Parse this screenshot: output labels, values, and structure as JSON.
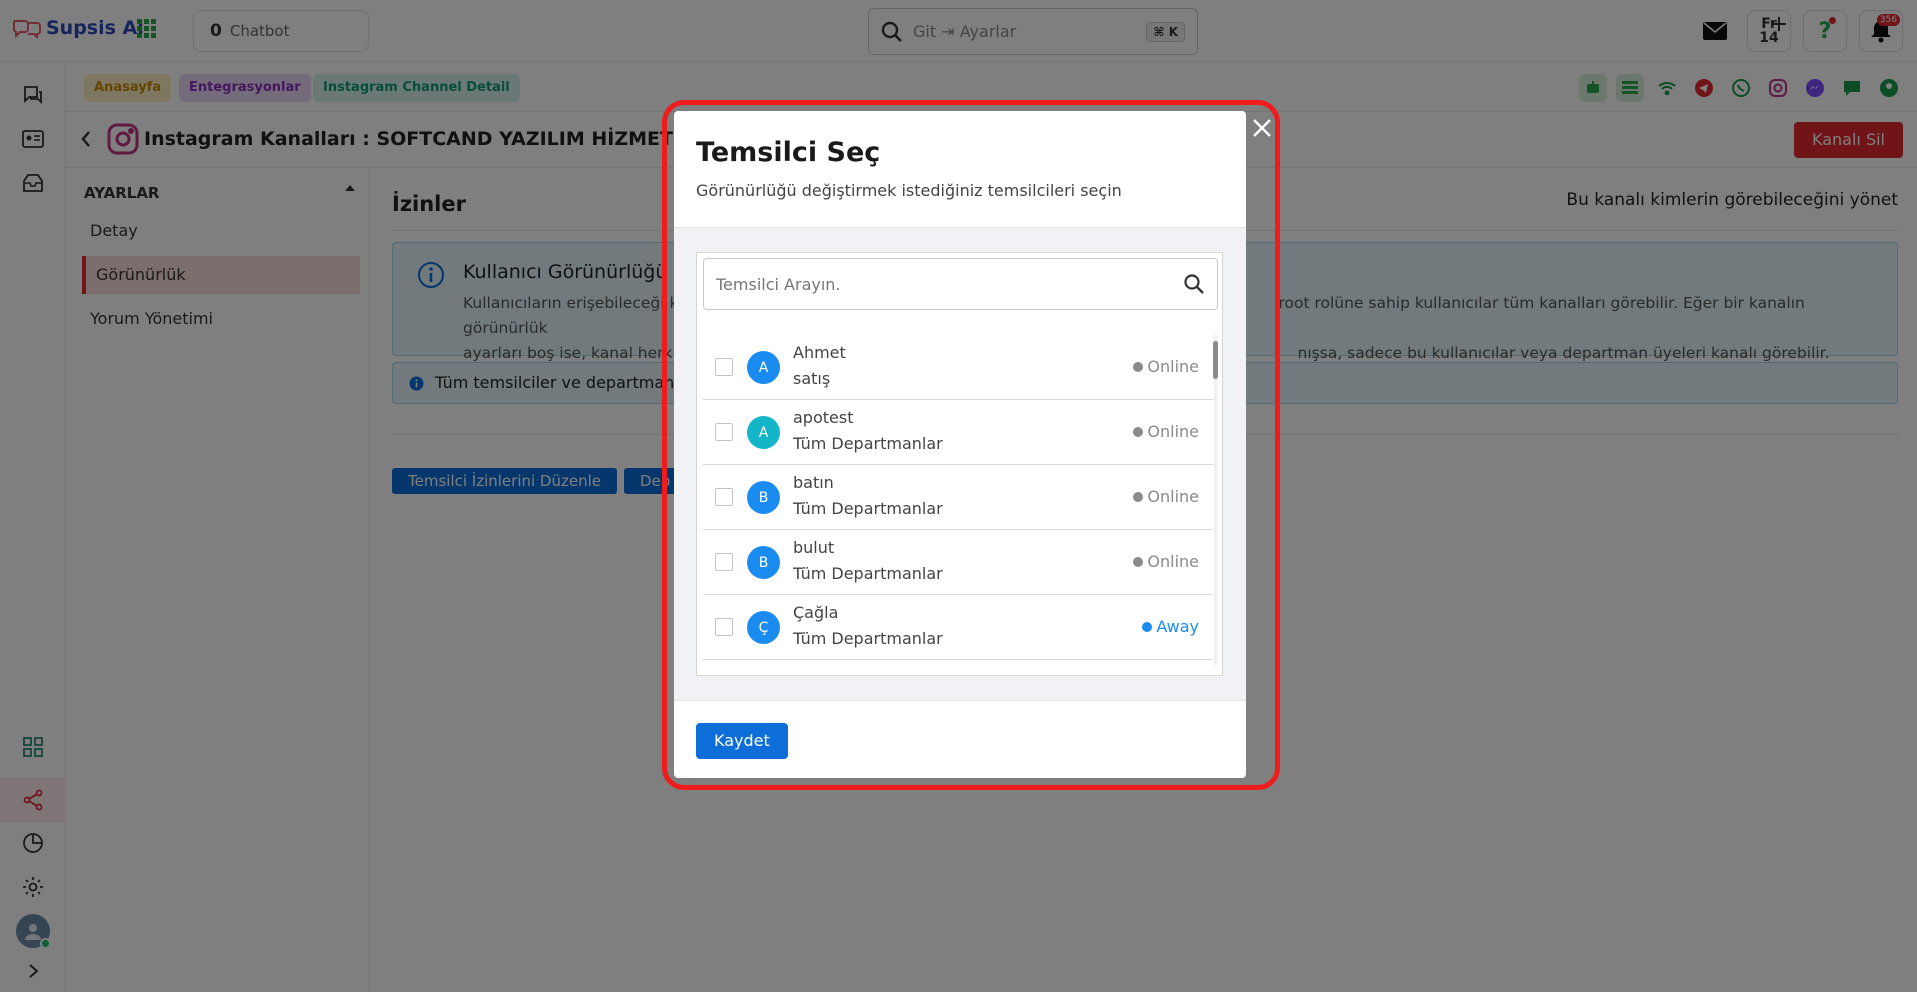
{
  "app": {
    "brand": "Supsis Ai"
  },
  "topbar": {
    "chatbot_count": "0",
    "chatbot_label": "Chatbot",
    "search_placeholder": "Git ⇥ Ayarlar",
    "search_shortcut": "⌘ K",
    "date_day": "Fr",
    "date_num": "14",
    "notification_count": "356"
  },
  "breadcrumb": [
    "Anasayfa",
    "Entegrasyonlar",
    "Instagram Channel Detail"
  ],
  "page": {
    "title": "Instagram Kanalları : SOFTCAND YAZILIM HİZMETLERİ",
    "delete_label": "Kanalı Sil"
  },
  "settings_sidebar": {
    "header": "AYARLAR",
    "items": [
      {
        "label": "Detay",
        "active": false
      },
      {
        "label": "Görünürlük",
        "active": true
      },
      {
        "label": "Yorum Yönetimi",
        "active": false
      }
    ]
  },
  "main": {
    "title": "İzinler",
    "right_text": "Bu kanalı kimlerin görebileceğini yönet",
    "info_title": "Kullanıcı Görünürlüğü",
    "info_text_left_1": "Kullanıcıların erişebileceği k",
    "info_text_right_1": "root rolüne sahip kullanıcılar tüm kanalları görebilir. Eğer bir kanalın görünürlük",
    "info_text_left_2": "ayarları boş ise, kanal herk",
    "info_text_right_2": "nışsa, sadece bu kullanıcılar veya departman üyeleri kanalı görebilir.",
    "info_bar_text": "Tüm temsilciler ve departmanla",
    "edit_agent_perms": "Temsilci İzinlerini Düzenle",
    "dept_button_partial": "Dep"
  },
  "modal": {
    "title": "Temsilci Seç",
    "subtitle": "Görünürlüğü değiştirmek istediğiniz temsilcileri seçin",
    "search_placeholder": "Temsilci Arayın.",
    "save_label": "Kaydet",
    "agents": [
      {
        "initial": "A",
        "name": "Ahmet",
        "department": "satış",
        "status": "Online",
        "avatar_color": "#1a8cf0",
        "status_color": "#8a8a8a"
      },
      {
        "initial": "A",
        "name": "apotest",
        "department": "Tüm Departmanlar",
        "status": "Online",
        "avatar_color": "#13b5c8",
        "status_color": "#8a8a8a"
      },
      {
        "initial": "B",
        "name": "batın",
        "department": "Tüm Departmanlar",
        "status": "Online",
        "avatar_color": "#1a8cf0",
        "status_color": "#8a8a8a"
      },
      {
        "initial": "B",
        "name": "bulut",
        "department": "Tüm Departmanlar",
        "status": "Online",
        "avatar_color": "#1a8cf0",
        "status_color": "#8a8a8a"
      },
      {
        "initial": "Ç",
        "name": "Çağla",
        "department": "Tüm Departmanlar",
        "status": "Away",
        "avatar_color": "#1a8cf0",
        "status_color": "#1a8cf0"
      }
    ]
  },
  "colors": {
    "accent": "#0d6ed9",
    "danger": "#e0282f",
    "highlight_frame": "#ee1c1c"
  }
}
